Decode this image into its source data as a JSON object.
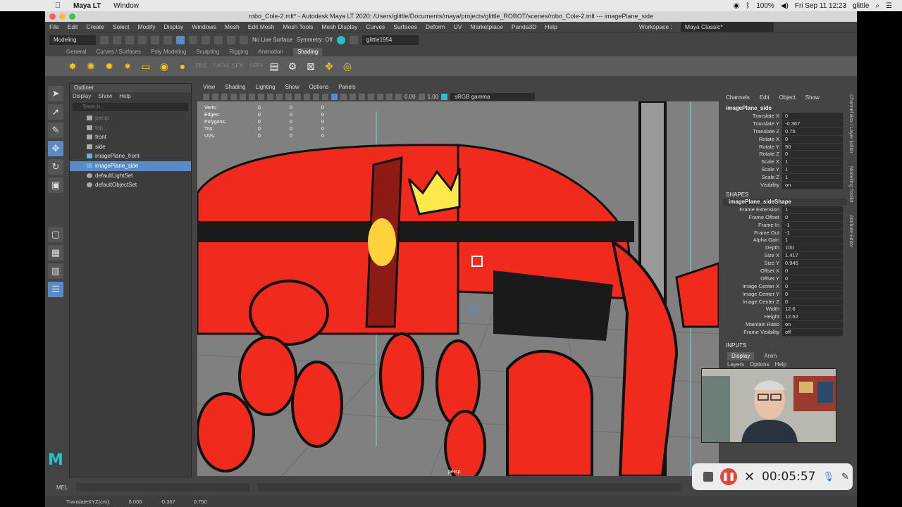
{
  "mac_menubar": {
    "apple": "",
    "app_name": "Maya LT",
    "menu_window": "Window",
    "battery": "100%",
    "clock": "Fri Sep 11  12:23",
    "user": "glittle"
  },
  "window": {
    "title": "robo_Cole-2.mlt* - Autodesk Maya LT 2020: /Users/glittle/Documents/maya/projects/glittle_ROBOT/scenes/robo_Cole-2.mlt  ---  imagePlane_side"
  },
  "main_menu": [
    "File",
    "Edit",
    "Create",
    "Select",
    "Modify",
    "Display",
    "Windows",
    "Mesh",
    "Edit Mesh",
    "Mesh Tools",
    "Mesh Display",
    "Curves",
    "Surfaces",
    "Deform",
    "UV",
    "Marketplace",
    "Panda3D",
    "Help"
  ],
  "workspace": {
    "label": "Workspace :",
    "value": "Maya Classic*"
  },
  "status_line": {
    "menu_set": "Modeling",
    "live_surface": "No Live Surface",
    "symmetry": "Symmetry: Off",
    "user": "glittle1954"
  },
  "shelf_tabs": [
    "General",
    "Curves / Surfaces",
    "Poly Modeling",
    "Sculpting",
    "Rigging",
    "Animation",
    "Shading"
  ],
  "shelf_active": "Shading",
  "shelf_icons": [
    "FBS",
    "TURTLE",
    "SFX",
    "CGFX"
  ],
  "outliner": {
    "title": "Outliner",
    "menu": [
      "Display",
      "Show",
      "Help"
    ],
    "search_placeholder": "Search...",
    "items": [
      {
        "label": "persp",
        "state": "dim"
      },
      {
        "label": "top",
        "state": "dim"
      },
      {
        "label": "front",
        "state": "normal"
      },
      {
        "label": "side",
        "state": "normal"
      },
      {
        "label": "imagePlane_front",
        "state": "normal"
      },
      {
        "label": "imagePlane_side",
        "state": "selected"
      },
      {
        "label": "defaultLightSet",
        "state": "normal"
      },
      {
        "label": "defaultObjectSet",
        "state": "normal"
      }
    ]
  },
  "viewport": {
    "menu": [
      "View",
      "Shading",
      "Lighting",
      "Show",
      "Options",
      "Panels"
    ],
    "exposure": "0.00",
    "gamma": "1.00",
    "color_space": "sRGB gamma",
    "hud": [
      {
        "label": "Verts:",
        "values": [
          "0",
          "0",
          "0"
        ]
      },
      {
        "label": "Edges:",
        "values": [
          "0",
          "0",
          "0"
        ]
      },
      {
        "label": "Polygons:",
        "values": [
          "0",
          "0",
          "0"
        ]
      },
      {
        "label": "Tris:",
        "values": [
          "0",
          "0",
          "0"
        ]
      },
      {
        "label": "UVs:",
        "values": [
          "0",
          "0",
          "0"
        ]
      }
    ],
    "camera_label": "persp"
  },
  "channel_box": {
    "tabs": [
      "Channels",
      "Edit",
      "Object",
      "Show"
    ],
    "object": "imagePlane_side",
    "transform": [
      {
        "k": "Translate X",
        "v": "0"
      },
      {
        "k": "Translate Y",
        "v": "-0.367"
      },
      {
        "k": "Translate Z",
        "v": "0.75"
      },
      {
        "k": "Rotate X",
        "v": "0"
      },
      {
        "k": "Rotate Y",
        "v": "90"
      },
      {
        "k": "Rotate Z",
        "v": "0"
      },
      {
        "k": "Scale X",
        "v": "1"
      },
      {
        "k": "Scale Y",
        "v": "1"
      },
      {
        "k": "Scale Z",
        "v": "1"
      },
      {
        "k": "Visibility",
        "v": "on"
      }
    ],
    "shapes_label": "SHAPES",
    "shape_name": "imagePlane_sideShape",
    "shape_attrs": [
      {
        "k": "Frame Extension",
        "v": "1"
      },
      {
        "k": "Frame Offset",
        "v": "0"
      },
      {
        "k": "Frame In",
        "v": "-1"
      },
      {
        "k": "Frame Out",
        "v": "-1"
      },
      {
        "k": "Alpha Gain",
        "v": "1"
      },
      {
        "k": "Depth",
        "v": "100"
      },
      {
        "k": "Size X",
        "v": "1.417"
      },
      {
        "k": "Size Y",
        "v": "0.945"
      },
      {
        "k": "Offset X",
        "v": "0"
      },
      {
        "k": "Offset Y",
        "v": "0"
      },
      {
        "k": "Image Center X",
        "v": "0"
      },
      {
        "k": "Image Center Y",
        "v": "0"
      },
      {
        "k": "Image Center Z",
        "v": "0"
      },
      {
        "k": "Width",
        "v": "12.6"
      },
      {
        "k": "Height",
        "v": "12.62"
      },
      {
        "k": "Maintain Ratio",
        "v": "on"
      },
      {
        "k": "Frame Visibility",
        "v": "off"
      }
    ],
    "inputs_label": "INPUTS",
    "layer_tabs": [
      "Display",
      "Anim"
    ],
    "layer_menu": [
      "Layers",
      "Options",
      "Help"
    ]
  },
  "right_tabs": [
    "Channel Box / Layer Editor",
    "Modelling Toolkit",
    "Attribute Editor"
  ],
  "command_line": {
    "label": "MEL"
  },
  "help_line": {
    "label": "TranslateXYZ(cm):",
    "x": "0.000",
    "y": "-0.367",
    "z": "0.750"
  },
  "recording": {
    "time": "00:05:57"
  },
  "colors": {
    "accent": "#5b8bc5",
    "robot_red": "#f02a1c",
    "maya_teal": "#27c1c9",
    "record_red": "#e0463b"
  }
}
